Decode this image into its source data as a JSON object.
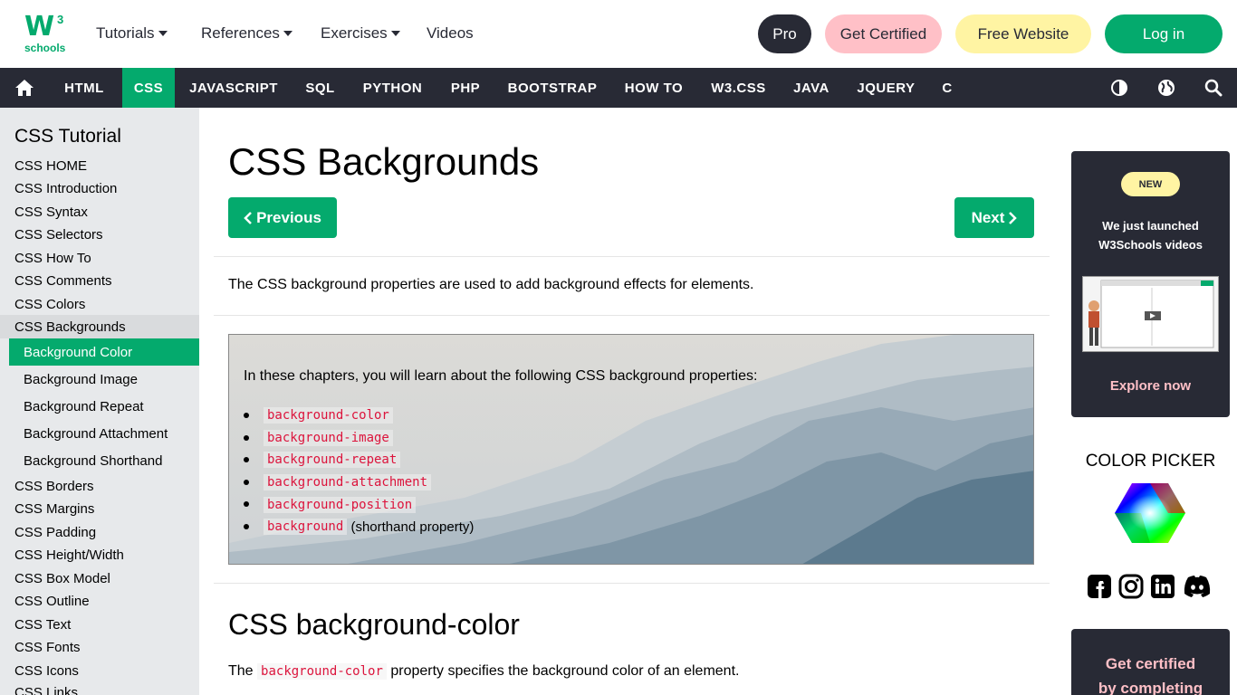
{
  "brand": {
    "w": "W",
    "sup": "3",
    "schools": "schools",
    "green": "#04AA6D",
    "dark": "#282A35"
  },
  "topnav": [
    {
      "label": "Tutorials",
      "dropdown": true
    },
    {
      "label": "References",
      "dropdown": true
    },
    {
      "label": "Exercises",
      "dropdown": true
    },
    {
      "label": "Videos",
      "dropdown": false
    }
  ],
  "pills": {
    "pro": "Pro",
    "cert": "Get Certified",
    "free": "Free Website",
    "login": "Log in"
  },
  "darknav": {
    "items": [
      "HTML",
      "CSS",
      "JAVASCRIPT",
      "SQL",
      "PYTHON",
      "PHP",
      "BOOTSTRAP",
      "HOW TO",
      "W3.CSS",
      "JAVA",
      "JQUERY",
      "C"
    ],
    "active": "CSS",
    "icons": [
      "home-icon",
      "contrast-icon",
      "globe-icon",
      "search-icon"
    ]
  },
  "sidebar": {
    "heading": "CSS Tutorial",
    "items_top": [
      "CSS HOME",
      "CSS Introduction",
      "CSS Syntax",
      "CSS Selectors",
      "CSS How To",
      "CSS Comments",
      "CSS Colors",
      "CSS Backgrounds"
    ],
    "sub_items": [
      "Background Color",
      "Background Image",
      "Background Repeat",
      "Background Attachment",
      "Background Shorthand"
    ],
    "items_bottom": [
      "CSS Borders",
      "CSS Margins",
      "CSS Padding",
      "CSS Height/Width",
      "CSS Box Model",
      "CSS Outline",
      "CSS Text",
      "CSS Fonts",
      "CSS Icons",
      "CSS Links"
    ]
  },
  "main": {
    "title": "CSS Backgrounds",
    "prev": "Previous",
    "next": "Next",
    "intro": "The CSS background properties are used to add background effects for elements.",
    "box_lead": "In these chapters, you will learn about the following CSS background properties:",
    "properties": [
      {
        "code": "background-color",
        "note": ""
      },
      {
        "code": "background-image",
        "note": ""
      },
      {
        "code": "background-repeat",
        "note": ""
      },
      {
        "code": "background-attachment",
        "note": ""
      },
      {
        "code": "background-position",
        "note": ""
      },
      {
        "code": "background",
        "note": "(shorthand property)"
      }
    ],
    "h2": "CSS background-color",
    "para_before": "The",
    "para_code": "background-color",
    "para_after": "property specifies the background color of an element."
  },
  "right": {
    "badge": "NEW",
    "promo_line1": "We just launched",
    "promo_line2": "W3Schools videos",
    "promo_link": "Explore now",
    "colorpicker": "COLOR PICKER",
    "social_icons": [
      "facebook-icon",
      "instagram-icon",
      "linkedin-icon",
      "discord-icon"
    ],
    "promo2_line1": "Get certified",
    "promo2_line2": "by completing"
  }
}
